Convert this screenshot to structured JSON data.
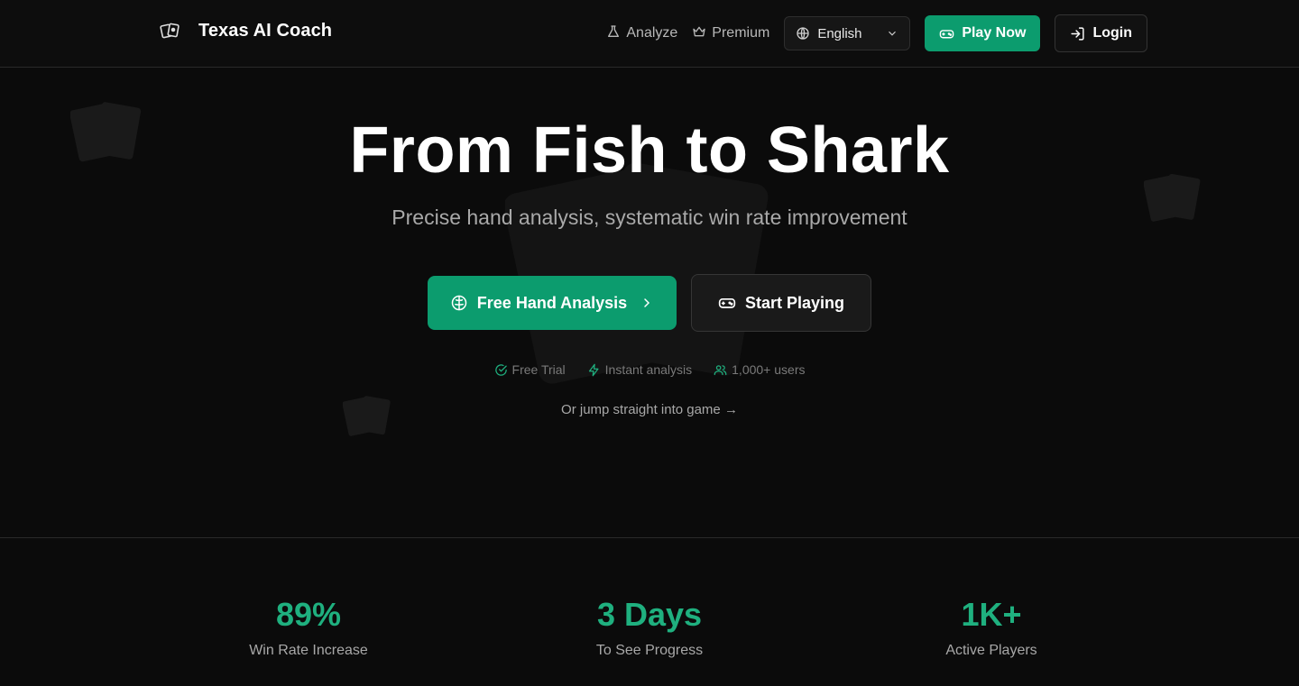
{
  "header": {
    "brand": "Texas AI Coach",
    "nav": [
      {
        "label": "Analyze",
        "icon": "flask-icon"
      },
      {
        "label": "Premium",
        "icon": "crown-icon"
      }
    ],
    "language": "English",
    "play_label": "Play Now",
    "login_label": "Login"
  },
  "hero": {
    "title": "From Fish to Shark",
    "subtitle": "Precise hand analysis, systematic win rate improvement",
    "primary_cta": "Free Hand Analysis",
    "secondary_cta": "Start Playing",
    "features": [
      "Free Trial",
      "Instant analysis",
      "1,000+ users"
    ],
    "jump_link": "Or jump straight into game →"
  },
  "stats": [
    {
      "value": "89%",
      "label": "Win Rate Increase"
    },
    {
      "value": "3 Days",
      "label": "To See Progress"
    },
    {
      "value": "1K+",
      "label": "Active Players"
    }
  ],
  "colors": {
    "accent": "#0c9c6e",
    "stat": "#1fb07f",
    "background": "#0b0b0b"
  }
}
